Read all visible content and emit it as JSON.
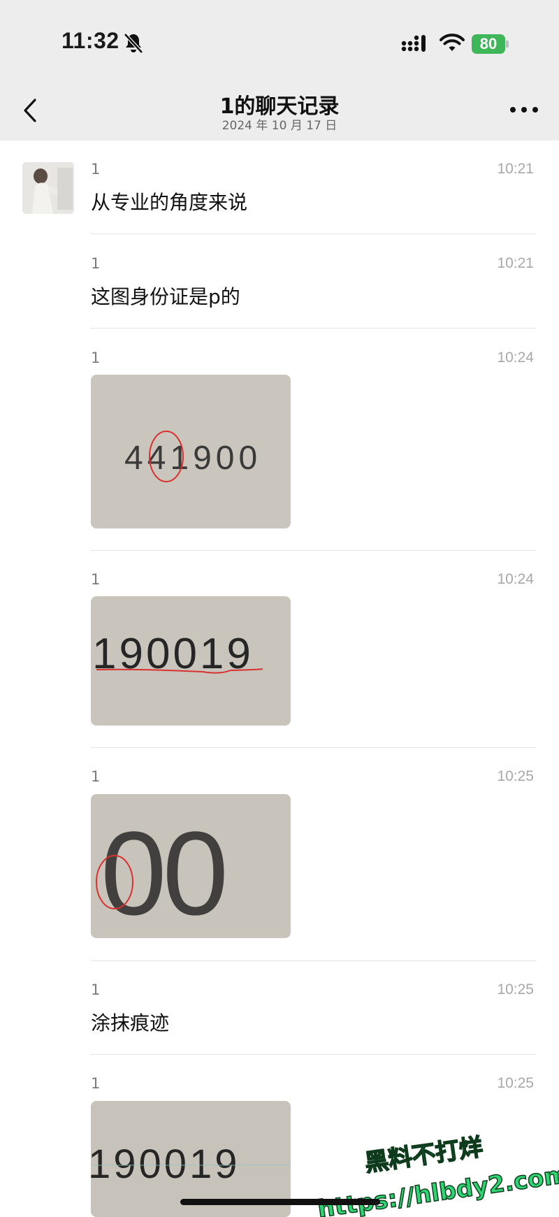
{
  "status_bar": {
    "time": "11:32",
    "battery": "80",
    "icons": [
      "bell-off-icon",
      "signal-icon",
      "wifi-icon",
      "battery-icon"
    ]
  },
  "nav": {
    "title": "1的聊天记录",
    "subtitle": "2024 年 10 月 17 日",
    "icons": [
      "chevron-left-icon",
      "more-icon"
    ]
  },
  "messages": [
    {
      "sender": "1",
      "time": "10:21",
      "type": "text",
      "text": "从专业的角度来说"
    },
    {
      "sender": "1",
      "time": "10:21",
      "type": "text",
      "text": "这图身份证是p的"
    },
    {
      "sender": "1",
      "time": "10:24",
      "type": "image",
      "image_text": "441900"
    },
    {
      "sender": "1",
      "time": "10:24",
      "type": "image",
      "image_text": "190019"
    },
    {
      "sender": "1",
      "time": "10:25",
      "type": "image",
      "image_text": "00"
    },
    {
      "sender": "1",
      "time": "10:25",
      "type": "text",
      "text": "涂抹痕迹"
    },
    {
      "sender": "1",
      "time": "10:25",
      "type": "image",
      "image_text": "190019"
    }
  ],
  "watermark": {
    "line1": "黑料不打烊",
    "line2": "https://hlbdy2.com"
  },
  "colors": {
    "header_bg": "#ededed",
    "battery_green": "#3fb65a",
    "annotation_red": "#d93030",
    "watermark_green": "#2ed573"
  }
}
